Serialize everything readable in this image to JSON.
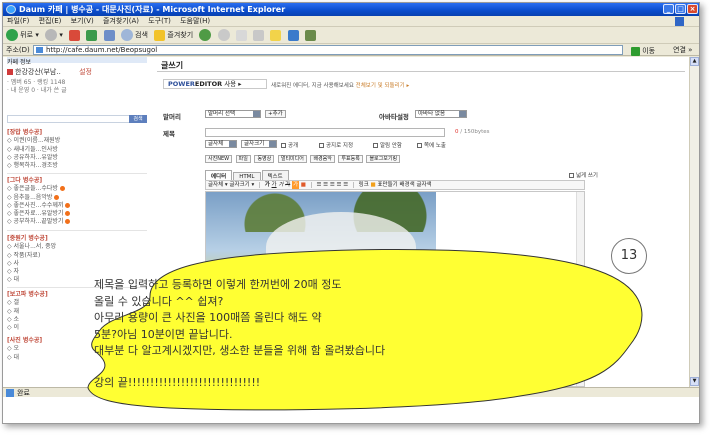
{
  "window": {
    "title": "Daum 카페 | 병수공 - 대문사진(자료) - Microsoft Internet Explorer",
    "controls": [
      "_",
      "□",
      "×"
    ]
  },
  "menu": [
    "파일(F)",
    "편집(E)",
    "보기(V)",
    "즐겨찾기(A)",
    "도구(T)",
    "도움말(H)"
  ],
  "toolbar": {
    "back": "뒤로",
    "search": "검색",
    "favorites": "즐겨찾기"
  },
  "address": {
    "label": "주소(D)",
    "url": "http://cafe.daum.net/Beopsugol",
    "go": "이동",
    "links": "연결 »"
  },
  "sidebar": {
    "top_text": "카페 정보",
    "cafe_name": "한강강산(부남..",
    "settings_link": "설정",
    "stats": [
      "· 멤버 65    · 랭킹 1148",
      "· 내 운영 0    · 내가 쓴 글"
    ],
    "search_button": "검색",
    "sections": [
      {
        "head": "[장맙 병수공]",
        "items": [
          "◇ 이권(이름...재원방",
          "◇ 새내기들...인사방",
          "◇ 공유하자...유알방",
          "◇ 행복하자...경조방"
        ]
      },
      {
        "head": "[그다 병수공]",
        "items": [
          "◇ 좋은글들...수다방",
          "◇ 음추들...음악방",
          "◇ 좋은사진...수수께끼",
          "◇ 좋은자료...유알방기",
          "◇ 공부하자...끝말방기"
        ]
      },
      {
        "head": "[중원기 병수공]",
        "items": [
          "◇ 서울나...서, 중앙",
          "◇ 작품(자료)",
          "◇ 사",
          "◇ 자",
          "◇ 대"
        ]
      },
      {
        "head": "[보고파 병수공]",
        "items": [
          "◇ 갤",
          "◇ 재",
          "◇ 소",
          "◇ 이"
        ]
      },
      {
        "head": "[사진 병수공]",
        "items": [
          "◇ 오",
          "◇ 대"
        ]
      }
    ]
  },
  "editor": {
    "page_title": "글쓰기",
    "brand_plain": "POWER",
    "brand_bold": "EDITOR",
    "brand_suffix": " 사용 ▸",
    "notice": "새로워진 에디터, 지금 사용해보세요",
    "notice_link": "전체보기 및 되돌리기 ▸",
    "head_label": "말머리",
    "head_select": "말머리 선택",
    "add_button": "+추가",
    "avatar_label": "아바타설정",
    "avatar_select": "아바타 없음",
    "title_label": "제목",
    "byte_count": "0",
    "byte_max": "/ 150bytes",
    "font_select": "글자체",
    "size_select": "글자크기",
    "options": [
      "공개",
      "공지로 지정",
      "알림 안함",
      "쪽에 노출"
    ],
    "attach": [
      "사진NEW",
      "파일",
      "동영상",
      "멀티미디어",
      "배경음악",
      "투표등록",
      "블로그보기링"
    ],
    "tabs": [
      "에디터",
      "HTML",
      "텍스트"
    ],
    "wide_checkbox": "넓게 쓰기",
    "toolbar_items": [
      "글자체",
      "글자크기",
      "가",
      "가",
      "가",
      "가",
      "가",
      "■",
      "☰",
      "☰",
      "☰",
      "☰",
      "☰",
      "링크",
      "■",
      "표만들기",
      "배경색",
      "글자색"
    ]
  },
  "status": {
    "text": "완료"
  },
  "callout": {
    "step_number": "13",
    "lines": [
      "제목을 입력하고 등록하면 이렇게 한꺼번에 20매 정도",
      "올릴 수 있습니다 ^^ 쉽져?",
      "아무리 용량이 큰 사진을 100매쯤 올린다 해도 약",
      "5분?아님 10분이면 끝납니다.",
      "대부분 다 알고계시겠지만, 생소한 분들을 위해 함 올려봤습니다"
    ],
    "end": "강의 끝!!!!!!!!!!!!!!!!!!!!!!!!!!!!!!",
    "fill_color": "#ffff33"
  }
}
